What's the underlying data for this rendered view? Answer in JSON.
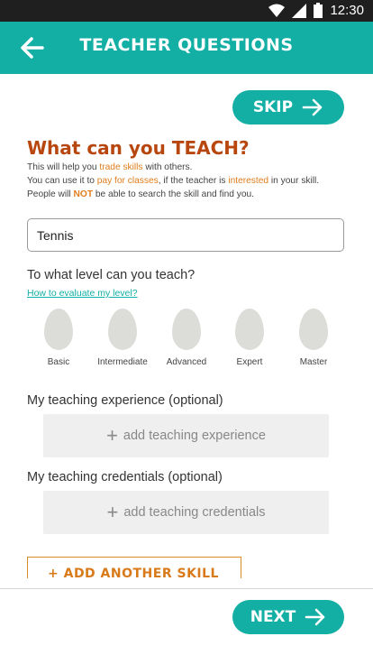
{
  "status_bar": {
    "time": "12:30"
  },
  "header": {
    "title": "TEACHER QUESTIONS"
  },
  "skip_label": "SKIP",
  "teach": {
    "title": "What can you TEACH?",
    "line1_a": "This will help you ",
    "line1_b": "trade skills",
    "line1_c": " with others.",
    "line2_a": "You can use it to ",
    "line2_b": "pay for classes",
    "line2_c": ", if the teacher is ",
    "line2_d": "interested",
    "line2_e": " in your skill.",
    "line3_a": "People will ",
    "line3_b": "NOT",
    "line3_c": " be able to search the skill and find you."
  },
  "skill_input": {
    "value": "Tennis"
  },
  "level": {
    "question": "To what level can you teach?",
    "link": "How to evaluate my level?",
    "options": [
      "Basic",
      "Intermediate",
      "Advanced",
      "Expert",
      "Master"
    ]
  },
  "experience": {
    "label": "My teaching experience (optional)",
    "button": "add teaching experience"
  },
  "credentials": {
    "label": "My teaching credentials  (optional)",
    "button": "add teaching credentials"
  },
  "another_skill": "+ ADD ANOTHER SKILL",
  "next_label": "NEXT",
  "colors": {
    "accent": "#13aea4",
    "title": "#b8470f",
    "highlight": "#e07d1d"
  }
}
